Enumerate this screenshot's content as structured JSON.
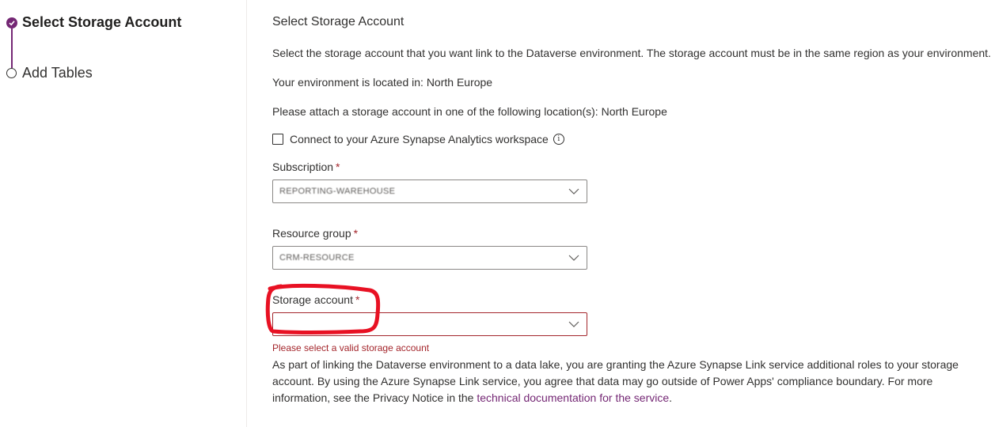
{
  "stepper": {
    "steps": [
      {
        "label": "Select Storage Account",
        "state": "active"
      },
      {
        "label": "Add Tables",
        "state": "pending"
      }
    ]
  },
  "main": {
    "title": "Select Storage Account",
    "intro": "Select the storage account that you want link to the Dataverse environment. The storage account must be in the same region as your environment.",
    "environment_location": "Your environment is located in: North Europe",
    "attach_location": "Please attach a storage account in one of the following location(s): North Europe",
    "synapse_checkbox": {
      "label": "Connect to your Azure Synapse Analytics workspace",
      "checked": false
    },
    "subscription": {
      "label": "Subscription",
      "required_mark": "*",
      "value": "REPORTING-WAREHOUSE"
    },
    "resource_group": {
      "label": "Resource group",
      "required_mark": "*",
      "value": "CRM-RESOURCE"
    },
    "storage_account": {
      "label": "Storage account",
      "required_mark": "*",
      "value": "",
      "error": "Please select a valid storage account"
    },
    "notice": {
      "text_before": "As part of linking the Dataverse environment to a data lake, you are granting the Azure Synapse Link service additional roles to your storage account. By using the Azure Synapse Link service, you agree that data may go outside of Power Apps' compliance boundary. For more information, see the Privacy Notice in the ",
      "link": "technical documentation for the service",
      "text_after": "."
    }
  },
  "colors": {
    "accent": "#742774",
    "error": "#a4262c",
    "annotation": "#e81123"
  }
}
